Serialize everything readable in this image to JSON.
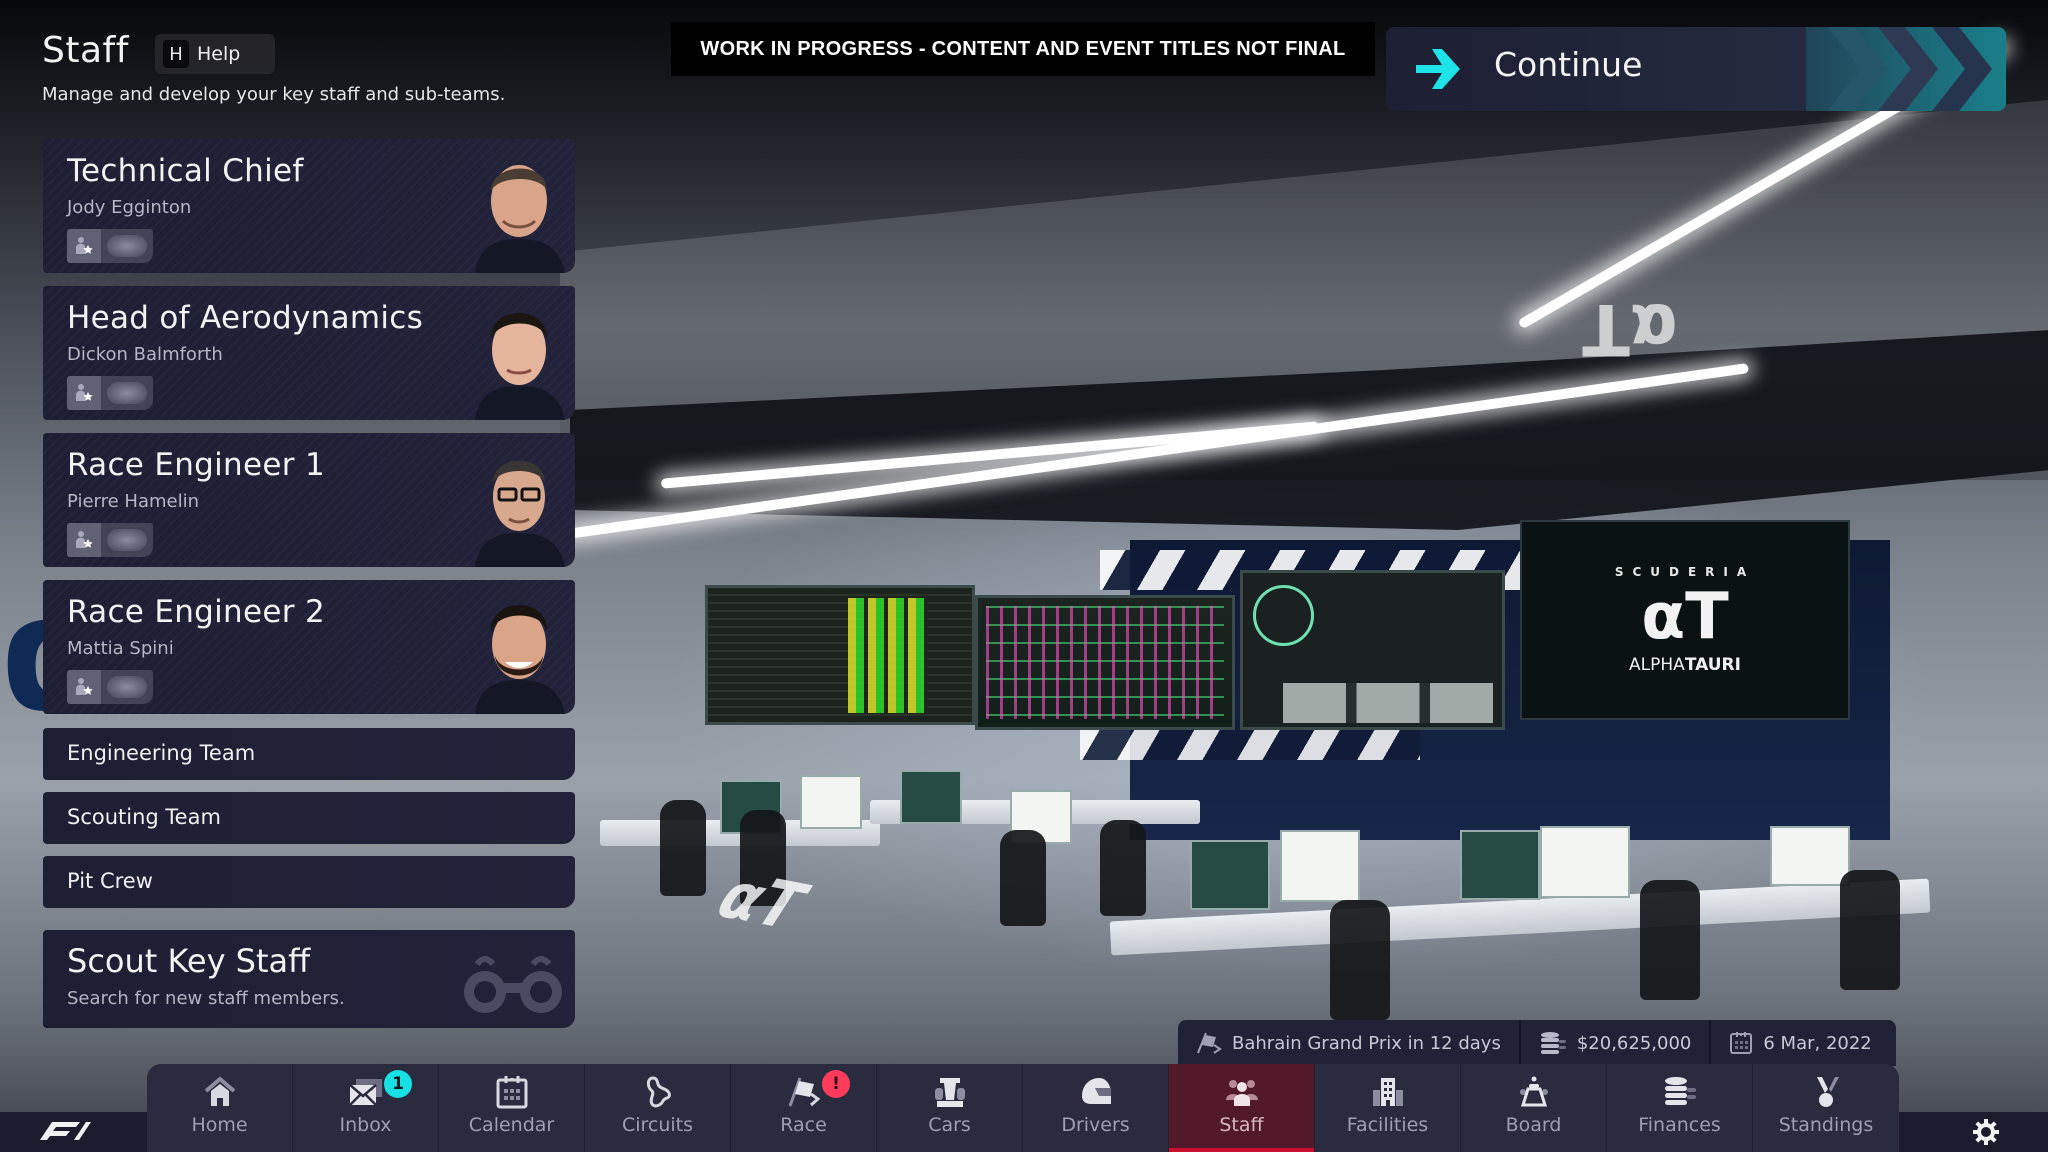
{
  "header": {
    "title": "Staff",
    "help_key": "H",
    "help_label": "Help",
    "subtitle": "Manage and develop your key staff and sub-teams."
  },
  "wip_banner": "WORK IN PROGRESS - CONTENT AND EVENT TITLES NOT FINAL",
  "continue_button": {
    "label": "Continue",
    "icon": "arrow-right-icon",
    "accent": "#1ee3e8"
  },
  "key_staff": [
    {
      "role": "Technical Chief",
      "name": "Jody Egginton",
      "badge_icon": "person-star-icon"
    },
    {
      "role": "Head of Aerodynamics",
      "name": "Dickon Balmforth",
      "badge_icon": "person-star-icon"
    },
    {
      "role": "Race Engineer 1",
      "name": "Pierre Hamelin",
      "badge_icon": "person-star-icon"
    },
    {
      "role": "Race Engineer 2",
      "name": "Mattia Spini",
      "badge_icon": "person-star-icon"
    }
  ],
  "sub_teams": [
    {
      "label": "Engineering Team"
    },
    {
      "label": "Scouting Team"
    },
    {
      "label": "Pit Crew"
    }
  ],
  "scout": {
    "title": "Scout Key Staff",
    "subtitle": "Search for new staff members.",
    "icon": "binoculars-icon"
  },
  "status_bar": {
    "next_event": "Bahrain Grand Prix in 12 days",
    "balance": "$20,625,000",
    "date": "6 Mar, 2022"
  },
  "nav": {
    "items": [
      {
        "label": "Home",
        "icon": "home-icon"
      },
      {
        "label": "Inbox",
        "icon": "mail-icon",
        "badge": "1"
      },
      {
        "label": "Calendar",
        "icon": "calendar-icon"
      },
      {
        "label": "Circuits",
        "icon": "circuit-icon"
      },
      {
        "label": "Race",
        "icon": "race-flag-icon",
        "badge": "!"
      },
      {
        "label": "Cars",
        "icon": "car-icon"
      },
      {
        "label": "Drivers",
        "icon": "helmet-icon"
      },
      {
        "label": "Staff",
        "icon": "staff-icon",
        "active": true
      },
      {
        "label": "Facilities",
        "icon": "building-icon"
      },
      {
        "label": "Board",
        "icon": "board-icon"
      },
      {
        "label": "Finances",
        "icon": "coins-icon"
      },
      {
        "label": "Standings",
        "icon": "medal-icon"
      }
    ],
    "active_color": "#52192a",
    "active_underline": "#c8102e"
  },
  "scene": {
    "team_screen_top": "SCUDERIA",
    "team_screen_brand_light": "ALPHA",
    "team_screen_brand_bold": "TAURI"
  }
}
